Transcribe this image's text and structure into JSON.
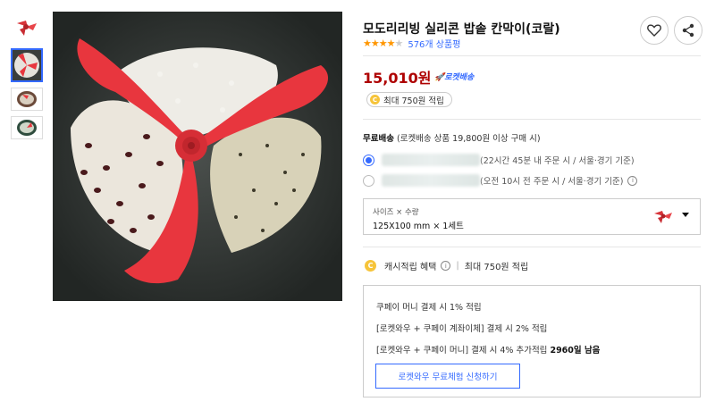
{
  "product": {
    "title": "모도리리빙 실리콘 밥솥 칸막이(코랄)",
    "rating": 4.5,
    "stars": "★★★★",
    "star_half": "★",
    "review_count": "576개 상품평",
    "price": "15,010원",
    "rocket_label": "🚀로켓배송",
    "cash_pill": "최대 750원 적립",
    "coin_char": "C"
  },
  "shipping": {
    "free_label": "무료배송",
    "condition": "(로켓배송 상품 19,800원 이상 구매 시)",
    "options": [
      {
        "text": "(22시간 45분 내 주문 시 / 서울·경기 기준)",
        "selected": true
      },
      {
        "text": "(오전 10시 전 주문 시 / 서울·경기 기준)",
        "selected": false
      }
    ],
    "info_char": "i"
  },
  "option_select": {
    "label": "사이즈 × 수량",
    "value": "125X100 mm × 1세트"
  },
  "cash_benefit": {
    "label": "캐시적립 혜택",
    "sep": "|",
    "max": "최대 750원 적립"
  },
  "benefit_box": {
    "line1": "쿠페이 머니 결제 시 1% 적립",
    "line2": "[로켓와우 + 쿠페이 계좌이체] 결제 시 2% 적립",
    "line3_prefix": "[로켓와우 + 쿠페이 머니] 결제 시 4% 추가적립 ",
    "line3_strong": "2960일 남음",
    "trial_button": "로켓와우 무료체험 신청하기"
  },
  "colors": {
    "price": "#ae0000",
    "link": "#346aff",
    "star": "#ff9600",
    "coral": "#e8363e"
  }
}
